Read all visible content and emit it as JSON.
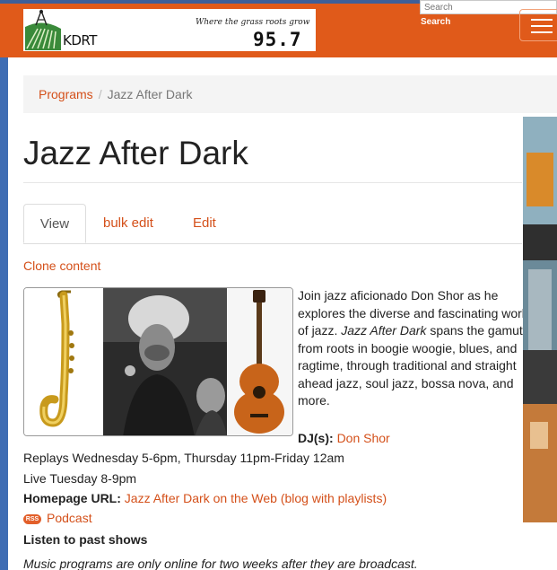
{
  "header": {
    "station_name": "KDRT",
    "tagline": "Where the grass roots grow",
    "frequency": "95.7",
    "search": {
      "placeholder": "Search",
      "button_label": "Search"
    },
    "menu_icon": "hamburger-icon",
    "colors": {
      "brand": "#e05a1a",
      "link": "#d4501a",
      "background": "#3f6db3"
    }
  },
  "breadcrumb": {
    "parent": "Programs",
    "separator": "/",
    "current": "Jazz After Dark"
  },
  "page": {
    "title": "Jazz After Dark",
    "tabs": [
      {
        "label": "View",
        "active": true
      },
      {
        "label": "bulk edit",
        "active": false
      },
      {
        "label": "Edit",
        "active": false
      }
    ],
    "clone_link": "Clone content"
  },
  "program": {
    "description_pre": "Join jazz aficionado Don Shor as he explores the diverse and fascinating world of jazz.",
    "description_title": "Jazz After Dark",
    "description_post": "spans the gamut, from roots in boogie woogie, blues, and ragtime, through traditional and straight ahead jazz, soul jazz, bossa nova, and more.",
    "dj_label": "DJ(s):",
    "dj_name": "Don Shor",
    "replays": "Replays Wednesday 5-6pm, Thursday 11pm-Friday 12am",
    "live": "Live Tuesday 8-9pm",
    "homepage_label": "Homepage URL:",
    "homepage_link": "Jazz After Dark on the Web (blog with playlists)",
    "rss_badge": "RSS",
    "podcast_label": "Podcast",
    "past_shows_label": "Listen to past shows",
    "note": "Music programs are only online for two weeks after they are broadcast."
  }
}
